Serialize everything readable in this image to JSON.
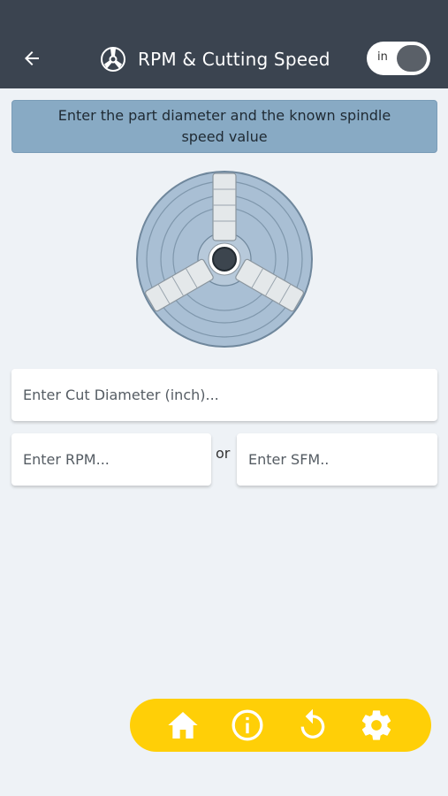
{
  "header": {
    "title": "RPM & Cutting Speed",
    "unit_toggle_label": "in",
    "icons": {
      "back": "arrow-left-icon",
      "logo": "lathe-chuck-logo-icon"
    }
  },
  "instruction": "Enter the part diameter and the known spindle speed value",
  "image": {
    "name": "three-jaw-chuck-illustration"
  },
  "inputs": {
    "diameter_placeholder": "Enter Cut Diameter (inch)...",
    "rpm_placeholder": "Enter RPM...",
    "sfm_placeholder": "Enter SFM.."
  },
  "or_label": "or",
  "bottom_nav": {
    "items": [
      "home-icon",
      "info-icon",
      "reset-icon",
      "settings-icon"
    ]
  },
  "colors": {
    "header_bg": "#3b4450",
    "page_bg": "#eef2f6",
    "instruction_bg": "#88aac4",
    "bottom_bar": "#ffcf07"
  }
}
